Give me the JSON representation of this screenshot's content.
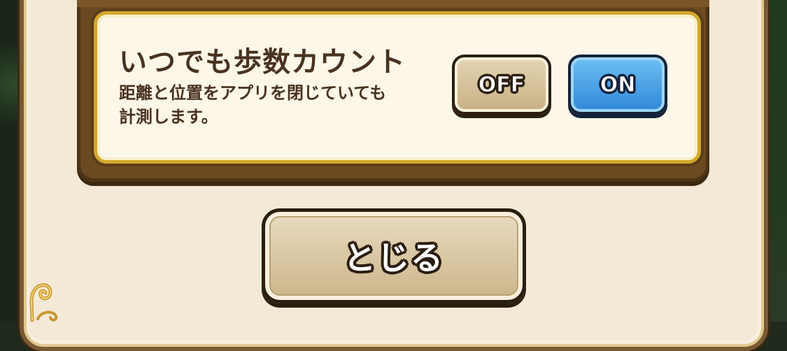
{
  "setting": {
    "title": "いつでも歩数カウント",
    "description_lines": [
      "距離と位置をアプリを閉じていても",
      "計測します。"
    ]
  },
  "toggle": {
    "off_label": "OFF",
    "on_label": "ON",
    "selected": "ON"
  },
  "dialog": {
    "close_label": "とじる"
  },
  "colors": {
    "panel_brown": "#6b4a22",
    "card_cream": "#fcf7e9",
    "gold_border": "#d4a72d",
    "on_blue": "#2f87d9",
    "off_beige": "#c8b083",
    "text_brown": "#4a3220"
  },
  "icons": {
    "corner_ornament": "scroll-ornament-icon"
  }
}
